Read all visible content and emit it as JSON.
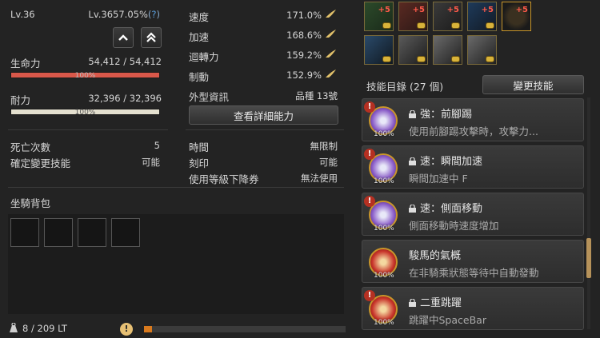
{
  "left": {
    "level_label": "Lv.36",
    "exp_percent": "Lv.3657.05%",
    "help": "?",
    "hp_label": "生命力",
    "hp_value": "54,412 / 54,412",
    "hp_pct": "100%",
    "hp_fill": 1.0,
    "stamina_label": "耐力",
    "stamina_value": "32,396 / 32,396",
    "stamina_pct": "100%",
    "stamina_fill": 1.0,
    "deaths_label": "死亡次數",
    "deaths_value": "5",
    "skill_change_label": "確定變更技能",
    "skill_change_value": "可能",
    "mount_bag_label": "坐騎背包",
    "weight": "8 / 209 LT"
  },
  "middle": {
    "stats": [
      {
        "label": "速度",
        "value": "171.0%"
      },
      {
        "label": "加速",
        "value": "168.6%"
      },
      {
        "label": "迴轉力",
        "value": "159.2%"
      },
      {
        "label": "制動",
        "value": "152.9%"
      }
    ],
    "appearance_label": "外型資訊",
    "appearance_value": "品種 13號",
    "detail_button": "查看詳細能力",
    "time_label": "時間",
    "time_value": "無限制",
    "imprint_label": "刻印",
    "imprint_value": "可能",
    "coupon_label": "使用等級下降券",
    "coupon_value": "無法使用"
  },
  "right": {
    "gear_row1": [
      "+5",
      "+5",
      "+5",
      "+5",
      "+5"
    ],
    "skills_header": "技能目錄 (27 個)",
    "change_skill_button": "變更技能",
    "skills": [
      {
        "title": "強：前腳踢",
        "desc": "使用前腳踢攻擊時，攻擊力...",
        "pct": "100%",
        "locked": true,
        "warn": true,
        "icon_color": "#8a5cc8"
      },
      {
        "title": "速：瞬間加速",
        "desc": "瞬間加速中 F",
        "pct": "100%",
        "locked": true,
        "warn": true,
        "icon_color": "#8a5cc8"
      },
      {
        "title": "速：側面移動",
        "desc": "側面移動時速度增加",
        "pct": "100%",
        "locked": true,
        "warn": true,
        "icon_color": "#8a5cc8"
      },
      {
        "title": "駿馬的氣概",
        "desc": "在非騎乘狀態等待中自動發動",
        "pct": "100%",
        "locked": false,
        "warn": false,
        "icon_color": "#c8342a"
      },
      {
        "title": "二重跳躍",
        "desc": "跳躍中SpaceBar",
        "pct": "100%",
        "locked": true,
        "warn": true,
        "icon_color": "#c8342a"
      }
    ]
  },
  "colors": {
    "hp_bar": "#d9584a",
    "stamina_bar": "#e4e0cf",
    "accent_gold": "#c9962a",
    "weight_bar": "#d97a1e"
  }
}
